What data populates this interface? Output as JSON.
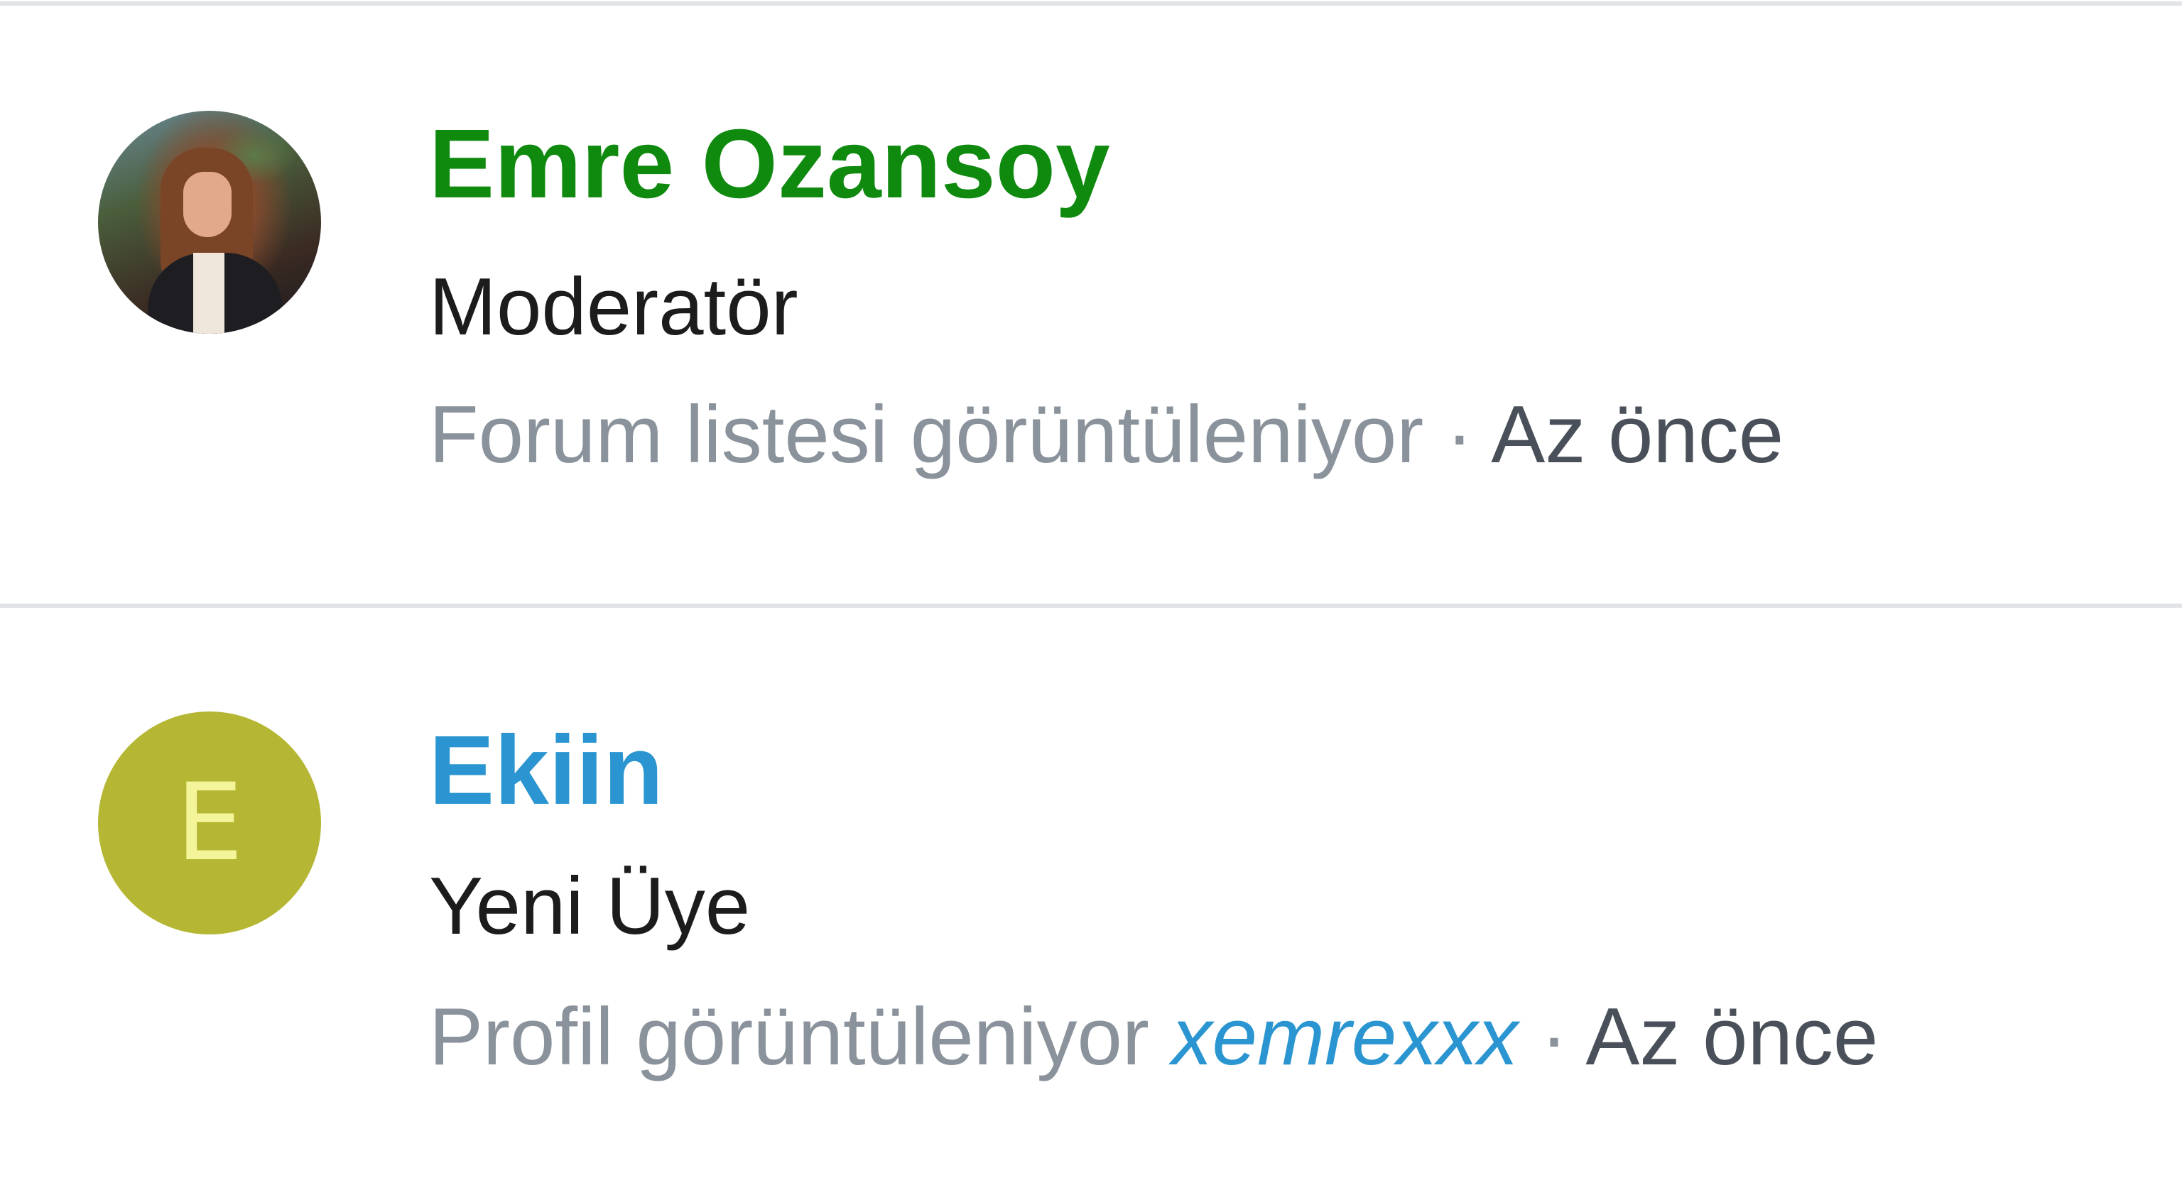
{
  "members": [
    {
      "name": "Emre Ozansoy",
      "name_color": "#0f8a0f",
      "role": "Moderatör",
      "activity": "Forum listesi görüntüleniyor",
      "separator": "·",
      "time": "Az önce"
    },
    {
      "name": "Ekiin",
      "name_color": "#2a95d0",
      "avatar_letter": "E",
      "avatar_color": "#b5b734",
      "role": "Yeni Üye",
      "activity": "Profil görüntüleniyor",
      "activity_link": "xemrexxx",
      "separator": "·",
      "time": "Az önce"
    }
  ],
  "colors": {
    "divider": "#e1e3e6",
    "meta_text": "#8a929b",
    "time_text": "#4a5059",
    "link": "#2a95d0"
  }
}
